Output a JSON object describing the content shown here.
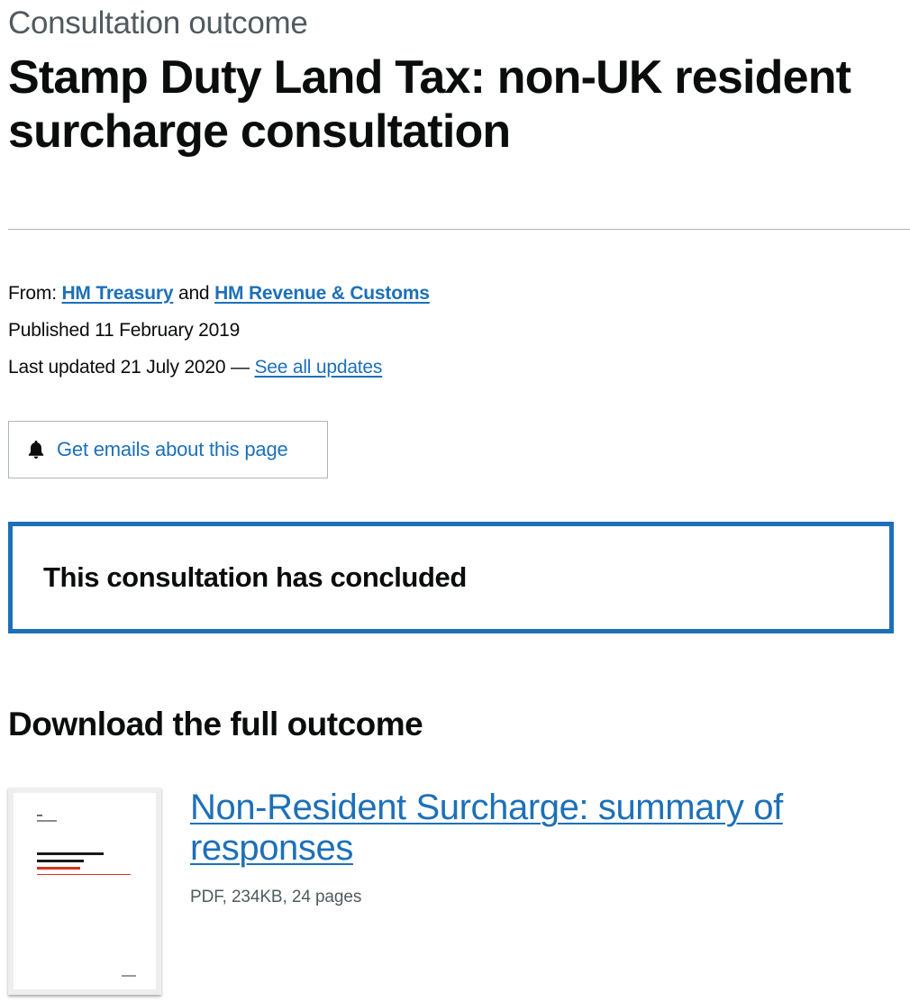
{
  "header": {
    "caption": "Consultation outcome",
    "title": "Stamp Duty Land Tax: non-UK resident surcharge consultation"
  },
  "metadata": {
    "from_label": "From:",
    "org1": "HM Treasury",
    "conjunction": "and",
    "org2": "HM Revenue & Customs",
    "published": "Published 11 February 2019",
    "last_updated": "Last updated 21 July 2020 —",
    "see_all_updates": "See all updates"
  },
  "email_button": {
    "icon": "bell-icon",
    "label": "Get emails about this page"
  },
  "notice": {
    "text": "This consultation has concluded"
  },
  "downloads": {
    "heading": "Download the full outcome",
    "attachment": {
      "title": "Non-Resident Surcharge: summary of responses",
      "meta": "PDF, 234KB, 24 pages"
    }
  },
  "colors": {
    "link": "#1d70b8",
    "text": "#0b0c0c",
    "secondary_text": "#505a5f",
    "border": "#b1b4b6",
    "accent_red": "#d4351c"
  }
}
